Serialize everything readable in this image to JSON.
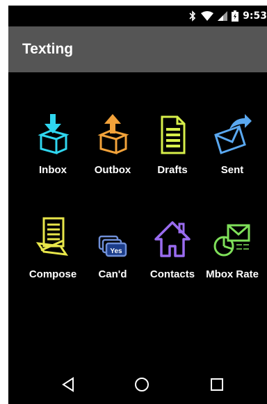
{
  "status_bar": {
    "time": "9:53",
    "icons": [
      "bluetooth-icon",
      "wifi-icon",
      "signal-icon",
      "battery-icon"
    ]
  },
  "app_bar": {
    "title": "Texting"
  },
  "grid": {
    "items": [
      {
        "label": "Inbox",
        "icon": "inbox-icon",
        "color": "#2fd6ef"
      },
      {
        "label": "Outbox",
        "icon": "outbox-icon",
        "color": "#f2a23a"
      },
      {
        "label": "Drafts",
        "icon": "drafts-icon",
        "color": "#d7ef4a"
      },
      {
        "label": "Sent",
        "icon": "sent-icon",
        "color": "#5aa8f0"
      },
      {
        "label": "Compose",
        "icon": "compose-icon",
        "color": "#e8e64a"
      },
      {
        "label": "Can'd",
        "icon": "canned-icon",
        "color": "#6f8fd8"
      },
      {
        "label": "Contacts",
        "icon": "contacts-icon",
        "color": "#9a6cf0"
      },
      {
        "label": "Mbox Rate",
        "icon": "mbox-rate-icon",
        "color": "#7fe05a"
      }
    ]
  },
  "nav_bar": {
    "icons": [
      "back-icon",
      "home-icon",
      "recents-icon"
    ]
  }
}
